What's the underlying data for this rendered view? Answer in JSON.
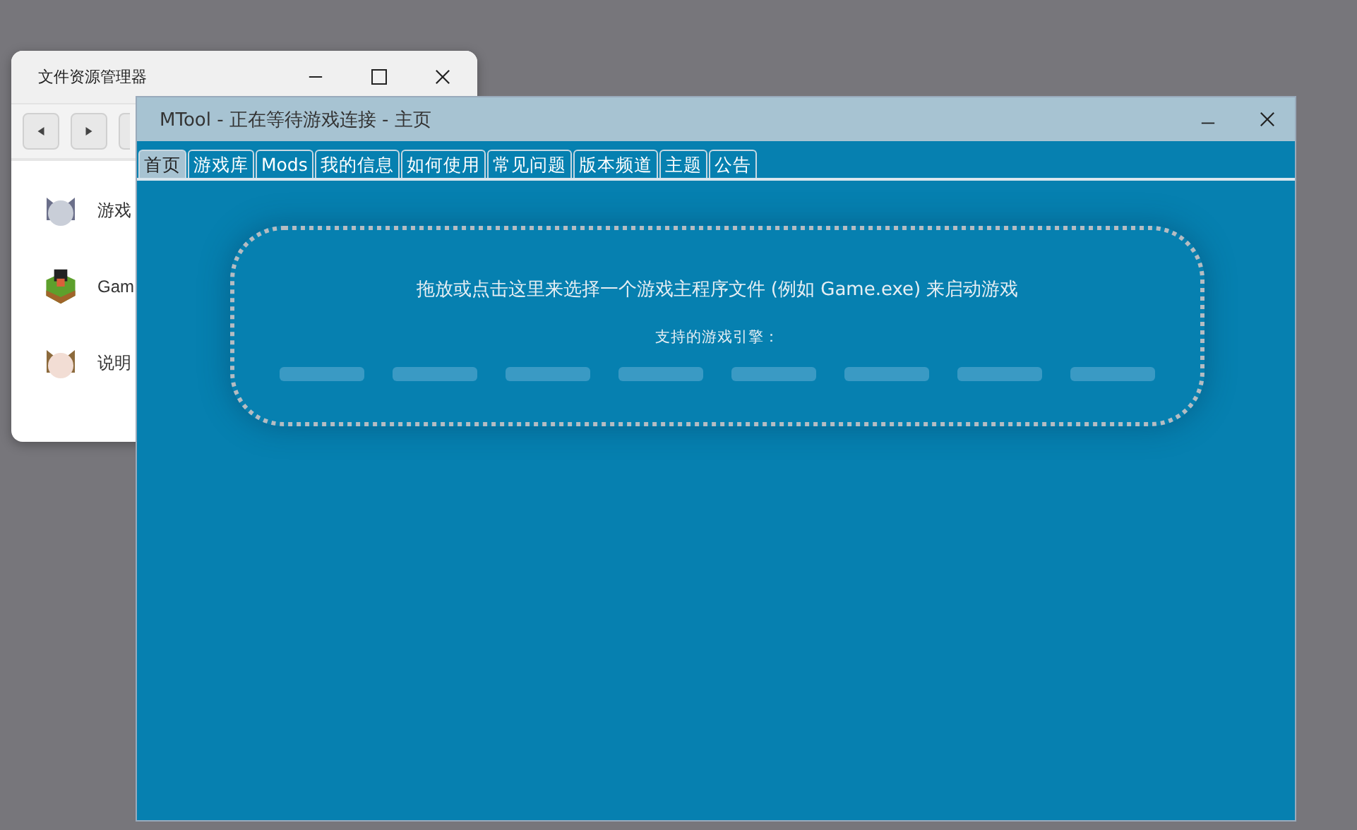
{
  "back_window": {
    "title": "文件资源管理器",
    "files": [
      {
        "name": "游戏",
        "kind": "avatar-gray"
      },
      {
        "name": "Gam",
        "kind": "cube"
      },
      {
        "name": "说明",
        "kind": "avatar-brown"
      }
    ]
  },
  "window": {
    "title": "MTool - 正在等待游戏连接 - 主页"
  },
  "tabs": [
    {
      "label": "首页",
      "selected": true
    },
    {
      "label": "游戏库",
      "selected": false
    },
    {
      "label": "Mods",
      "selected": false
    },
    {
      "label": "我的信息",
      "selected": false
    },
    {
      "label": "如何使用",
      "selected": false
    },
    {
      "label": "常见问题",
      "selected": false
    },
    {
      "label": "版本频道",
      "selected": false
    },
    {
      "label": "主题",
      "selected": false
    },
    {
      "label": "公告",
      "selected": false
    }
  ],
  "drop_zone": {
    "instruction": "拖放或点击这里来选择一个游戏主程序文件 (例如 Game.exe) 来启动游戏",
    "engines_label": "支持的游戏引擎："
  }
}
